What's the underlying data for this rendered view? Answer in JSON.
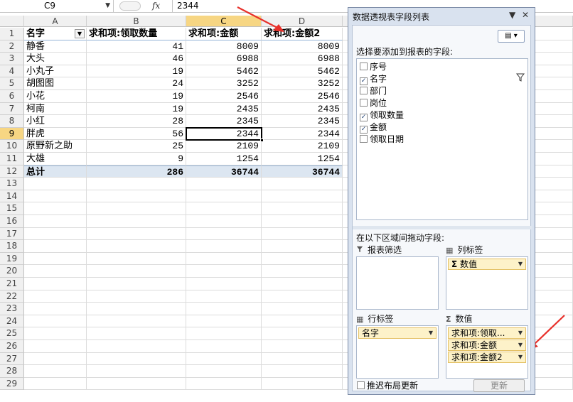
{
  "formula_bar": {
    "name_box": "C9",
    "fx_label": "fx",
    "content": "2344"
  },
  "sheet": {
    "columns": [
      "A",
      "B",
      "C",
      "D"
    ],
    "selected_column": "C",
    "selected_row": "9",
    "row_numbers": [
      "1",
      "2",
      "3",
      "4",
      "5",
      "6",
      "7",
      "8",
      "9",
      "10",
      "11",
      "12",
      "13",
      "14",
      "15",
      "16",
      "17",
      "18",
      "19",
      "20",
      "21",
      "22",
      "23",
      "24",
      "25",
      "26",
      "27",
      "28",
      "29"
    ],
    "headers": {
      "a": "名字",
      "b": "求和项:领取数量",
      "c": "求和项:金额",
      "d": "求和项:金额2"
    },
    "rows": [
      {
        "name": "静香",
        "qty": "41",
        "amt": "8009",
        "amt2": "8009"
      },
      {
        "name": "大头",
        "qty": "46",
        "amt": "6988",
        "amt2": "6988"
      },
      {
        "name": "小丸子",
        "qty": "19",
        "amt": "5462",
        "amt2": "5462"
      },
      {
        "name": "胡图图",
        "qty": "24",
        "amt": "3252",
        "amt2": "3252"
      },
      {
        "name": "小花",
        "qty": "19",
        "amt": "2546",
        "amt2": "2546"
      },
      {
        "name": "柯南",
        "qty": "19",
        "amt": "2435",
        "amt2": "2435"
      },
      {
        "name": "小红",
        "qty": "28",
        "amt": "2345",
        "amt2": "2345"
      },
      {
        "name": "胖虎",
        "qty": "56",
        "amt": "2344",
        "amt2": "2344"
      },
      {
        "name": "原野新之助",
        "qty": "25",
        "amt": "2109",
        "amt2": "2109"
      },
      {
        "name": "大雄",
        "qty": "9",
        "amt": "1254",
        "amt2": "1254"
      }
    ],
    "total": {
      "name": "总计",
      "qty": "286",
      "amt": "36744",
      "amt2": "36744"
    }
  },
  "pivot_pane": {
    "title": "数据透视表字段列表",
    "choose_fields_label": "选择要添加到报表的字段:",
    "fields": [
      {
        "label": "序号",
        "checked": false
      },
      {
        "label": "名字",
        "checked": true
      },
      {
        "label": "部门",
        "checked": false
      },
      {
        "label": "岗位",
        "checked": false
      },
      {
        "label": "领取数量",
        "checked": true
      },
      {
        "label": "金额",
        "checked": true
      },
      {
        "label": "领取日期",
        "checked": false
      }
    ],
    "drag_areas_label": "在以下区域间拖动字段:",
    "report_filter_label": "报表筛选",
    "column_labels_label": "列标签",
    "row_labels_label": "行标签",
    "values_label": "数值",
    "column_items": [
      "数值"
    ],
    "row_items": [
      "名字"
    ],
    "value_items": [
      "求和项:领取...",
      "求和项:金额",
      "求和项:金额2"
    ],
    "defer_update_label": "推迟布局更新",
    "update_button": "更新"
  },
  "annotation_color": "#e8302a"
}
